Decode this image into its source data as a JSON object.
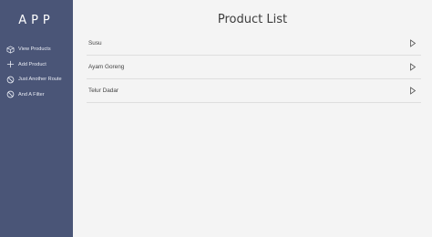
{
  "sidebar": {
    "app_title": "APP",
    "items": [
      {
        "label": "View Products",
        "icon": "cube-icon"
      },
      {
        "label": "Add Product",
        "icon": "plus-icon"
      },
      {
        "label": "Just Another Route",
        "icon": "block-icon"
      },
      {
        "label": "And A Filter",
        "icon": "block-icon"
      }
    ]
  },
  "main": {
    "title": "Product List",
    "products": [
      {
        "name": "Susu"
      },
      {
        "name": "Ayam Goreng"
      },
      {
        "name": "Telur Dadar"
      }
    ]
  },
  "colors": {
    "sidebar_bg": "#4a5577",
    "content_bg": "#f4f4f4",
    "divider": "#dedede"
  }
}
